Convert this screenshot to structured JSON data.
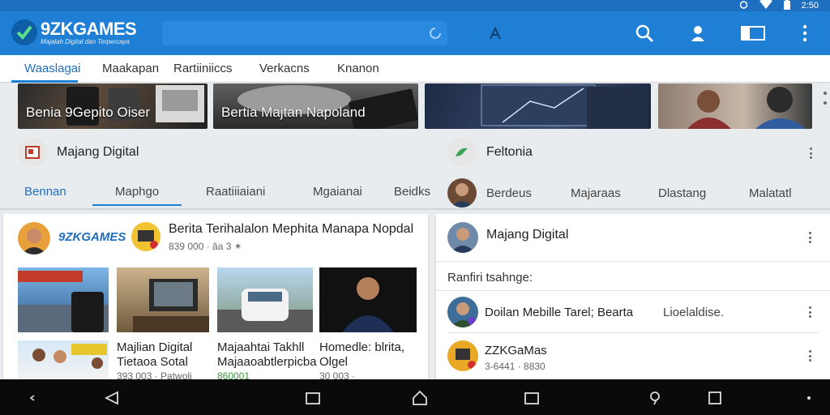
{
  "status": {
    "time": "2:50"
  },
  "app": {
    "name": "9ZKGAMES",
    "tagline": "Majalah Digital dan Terpercaya"
  },
  "search": {
    "value": "",
    "placeholder": ""
  },
  "tabs": [
    "Waaslagai",
    "Maakapan",
    "Rartiiniiccs",
    "Verkacns",
    "Knanon"
  ],
  "features": [
    {
      "caption": "Benia 9Gepito Oiser"
    },
    {
      "caption": "Bertia Majtan Napoland"
    },
    {
      "caption": ""
    },
    {
      "caption": ""
    }
  ],
  "sections": {
    "left_title": "Majang Digital",
    "right_title": "Feltonia"
  },
  "subtabs_left": [
    "Bennan",
    "Maphgo",
    "Raatiiiaiani",
    "Mgaianai",
    "Beidks"
  ],
  "subtabs_right": [
    "Berdeus",
    "Majaraas",
    "Dlastang",
    "Malatatl"
  ],
  "post": {
    "brand": "9ZKGAMES",
    "title": "Berita Terihalalon Mephita Manapa Nopdal",
    "meta": "839 000 · âa 3 ✴",
    "items": [
      {
        "title1": "Majlian Digital",
        "title2": "Tietaoa Sotal",
        "meta": "393 003 · Patwoli"
      },
      {
        "title1": "Majaahtai Takhll",
        "title2": "Majaaoabtlerpicba",
        "meta": "860001"
      },
      {
        "title1": "Homedle: blrita,",
        "title2": "Olgel",
        "meta": "30 003 ·"
      }
    ]
  },
  "right_card": {
    "title": "Majang Digital",
    "heading": "Ranfiri tsahnge:",
    "rows": [
      {
        "title": "Doilan Mebille Tarel; Bearta",
        "extra": "Lioelaldise."
      },
      {
        "title": "ZZKGaMas",
        "sub": "3-6441 · 8830"
      }
    ]
  },
  "colors": {
    "primary": "#1f7fd4",
    "status": "#1f6fc0",
    "accent": "#1f6fc0"
  }
}
